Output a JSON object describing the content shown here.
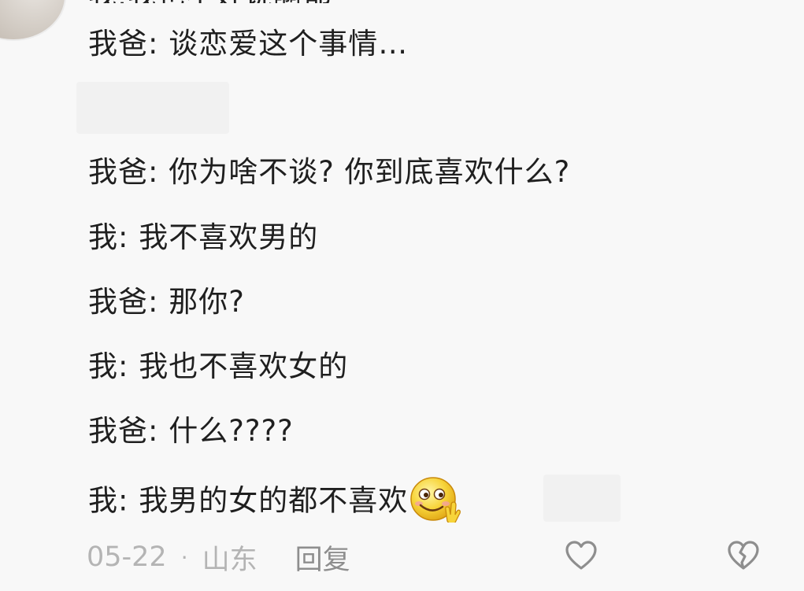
{
  "comment": {
    "lines": [
      {
        "speaker": "我爸",
        "text": "谈恋爱这个事情…"
      },
      {
        "speaker": "我爸",
        "text": "你为啥不谈? 你到底喜欢什么?"
      },
      {
        "speaker": "我",
        "text": "我不喜欢男的"
      },
      {
        "speaker": "我爸",
        "text": "那你?"
      },
      {
        "speaker": "我",
        "text": "我也不喜欢女的"
      },
      {
        "speaker": "我爸",
        "text": "什么????"
      },
      {
        "speaker": "我",
        "text": "我男的女的都不喜欢"
      }
    ],
    "separator": ": ",
    "emoji": "smirk-peace-emoji"
  },
  "footer": {
    "date": "05-22",
    "dot": "·",
    "location": "山东",
    "reply_label": "回复",
    "like_icon": "heart-outline-icon",
    "dislike_icon": "broken-heart-icon"
  },
  "colors": {
    "background": "#f8f8f8",
    "text": "#1f1f1f",
    "meta": "#b4b4b4",
    "icon": "#8e8e8e"
  }
}
